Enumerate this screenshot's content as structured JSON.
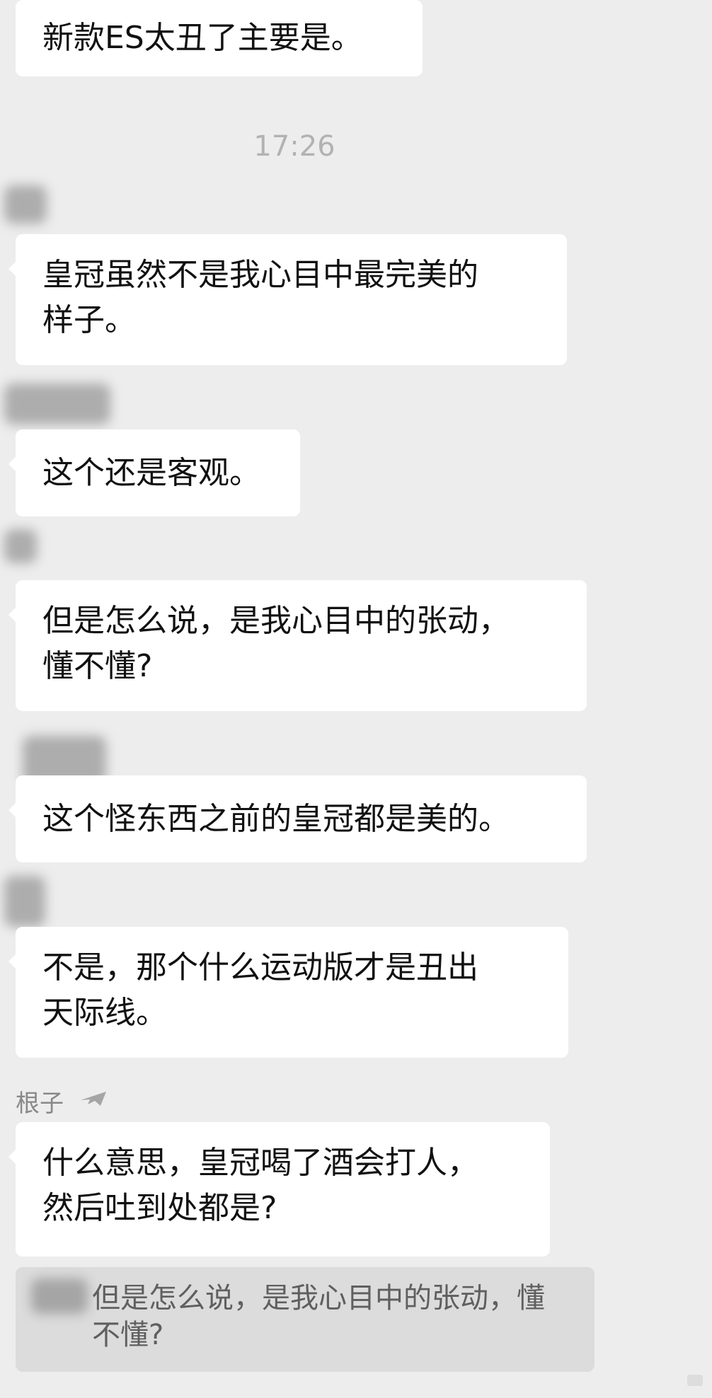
{
  "chat": {
    "timestamp": "17:26",
    "sender_name": "根子",
    "messages": [
      {
        "text": "新款ES太丑了主要是。"
      },
      {
        "text": "皇冠虽然不是我心目中最完美的\n样子。"
      },
      {
        "text": "这个还是客观。"
      },
      {
        "text": "但是怎么说，是我心目中的张动，\n懂不懂?"
      },
      {
        "text": "这个怪东西之前的皇冠都是美的。"
      },
      {
        "text": "不是，那个什么运动版才是丑出\n天际线。"
      },
      {
        "text": "什么意思，皇冠喝了酒会打人，\n然后吐到处都是?"
      }
    ],
    "quote": {
      "text": "但是怎么说，是我心目中的张动，懂\n不懂?"
    }
  },
  "icons": {
    "sender_icon": "plane-icon",
    "watermark_icon": "corner-mark-icon"
  },
  "colors": {
    "background": "#ededed",
    "bubble": "#ffffff",
    "timestamp": "#b2b2b2",
    "quote_bg": "#dcdcdc",
    "quote_text": "#5f5f5f"
  }
}
